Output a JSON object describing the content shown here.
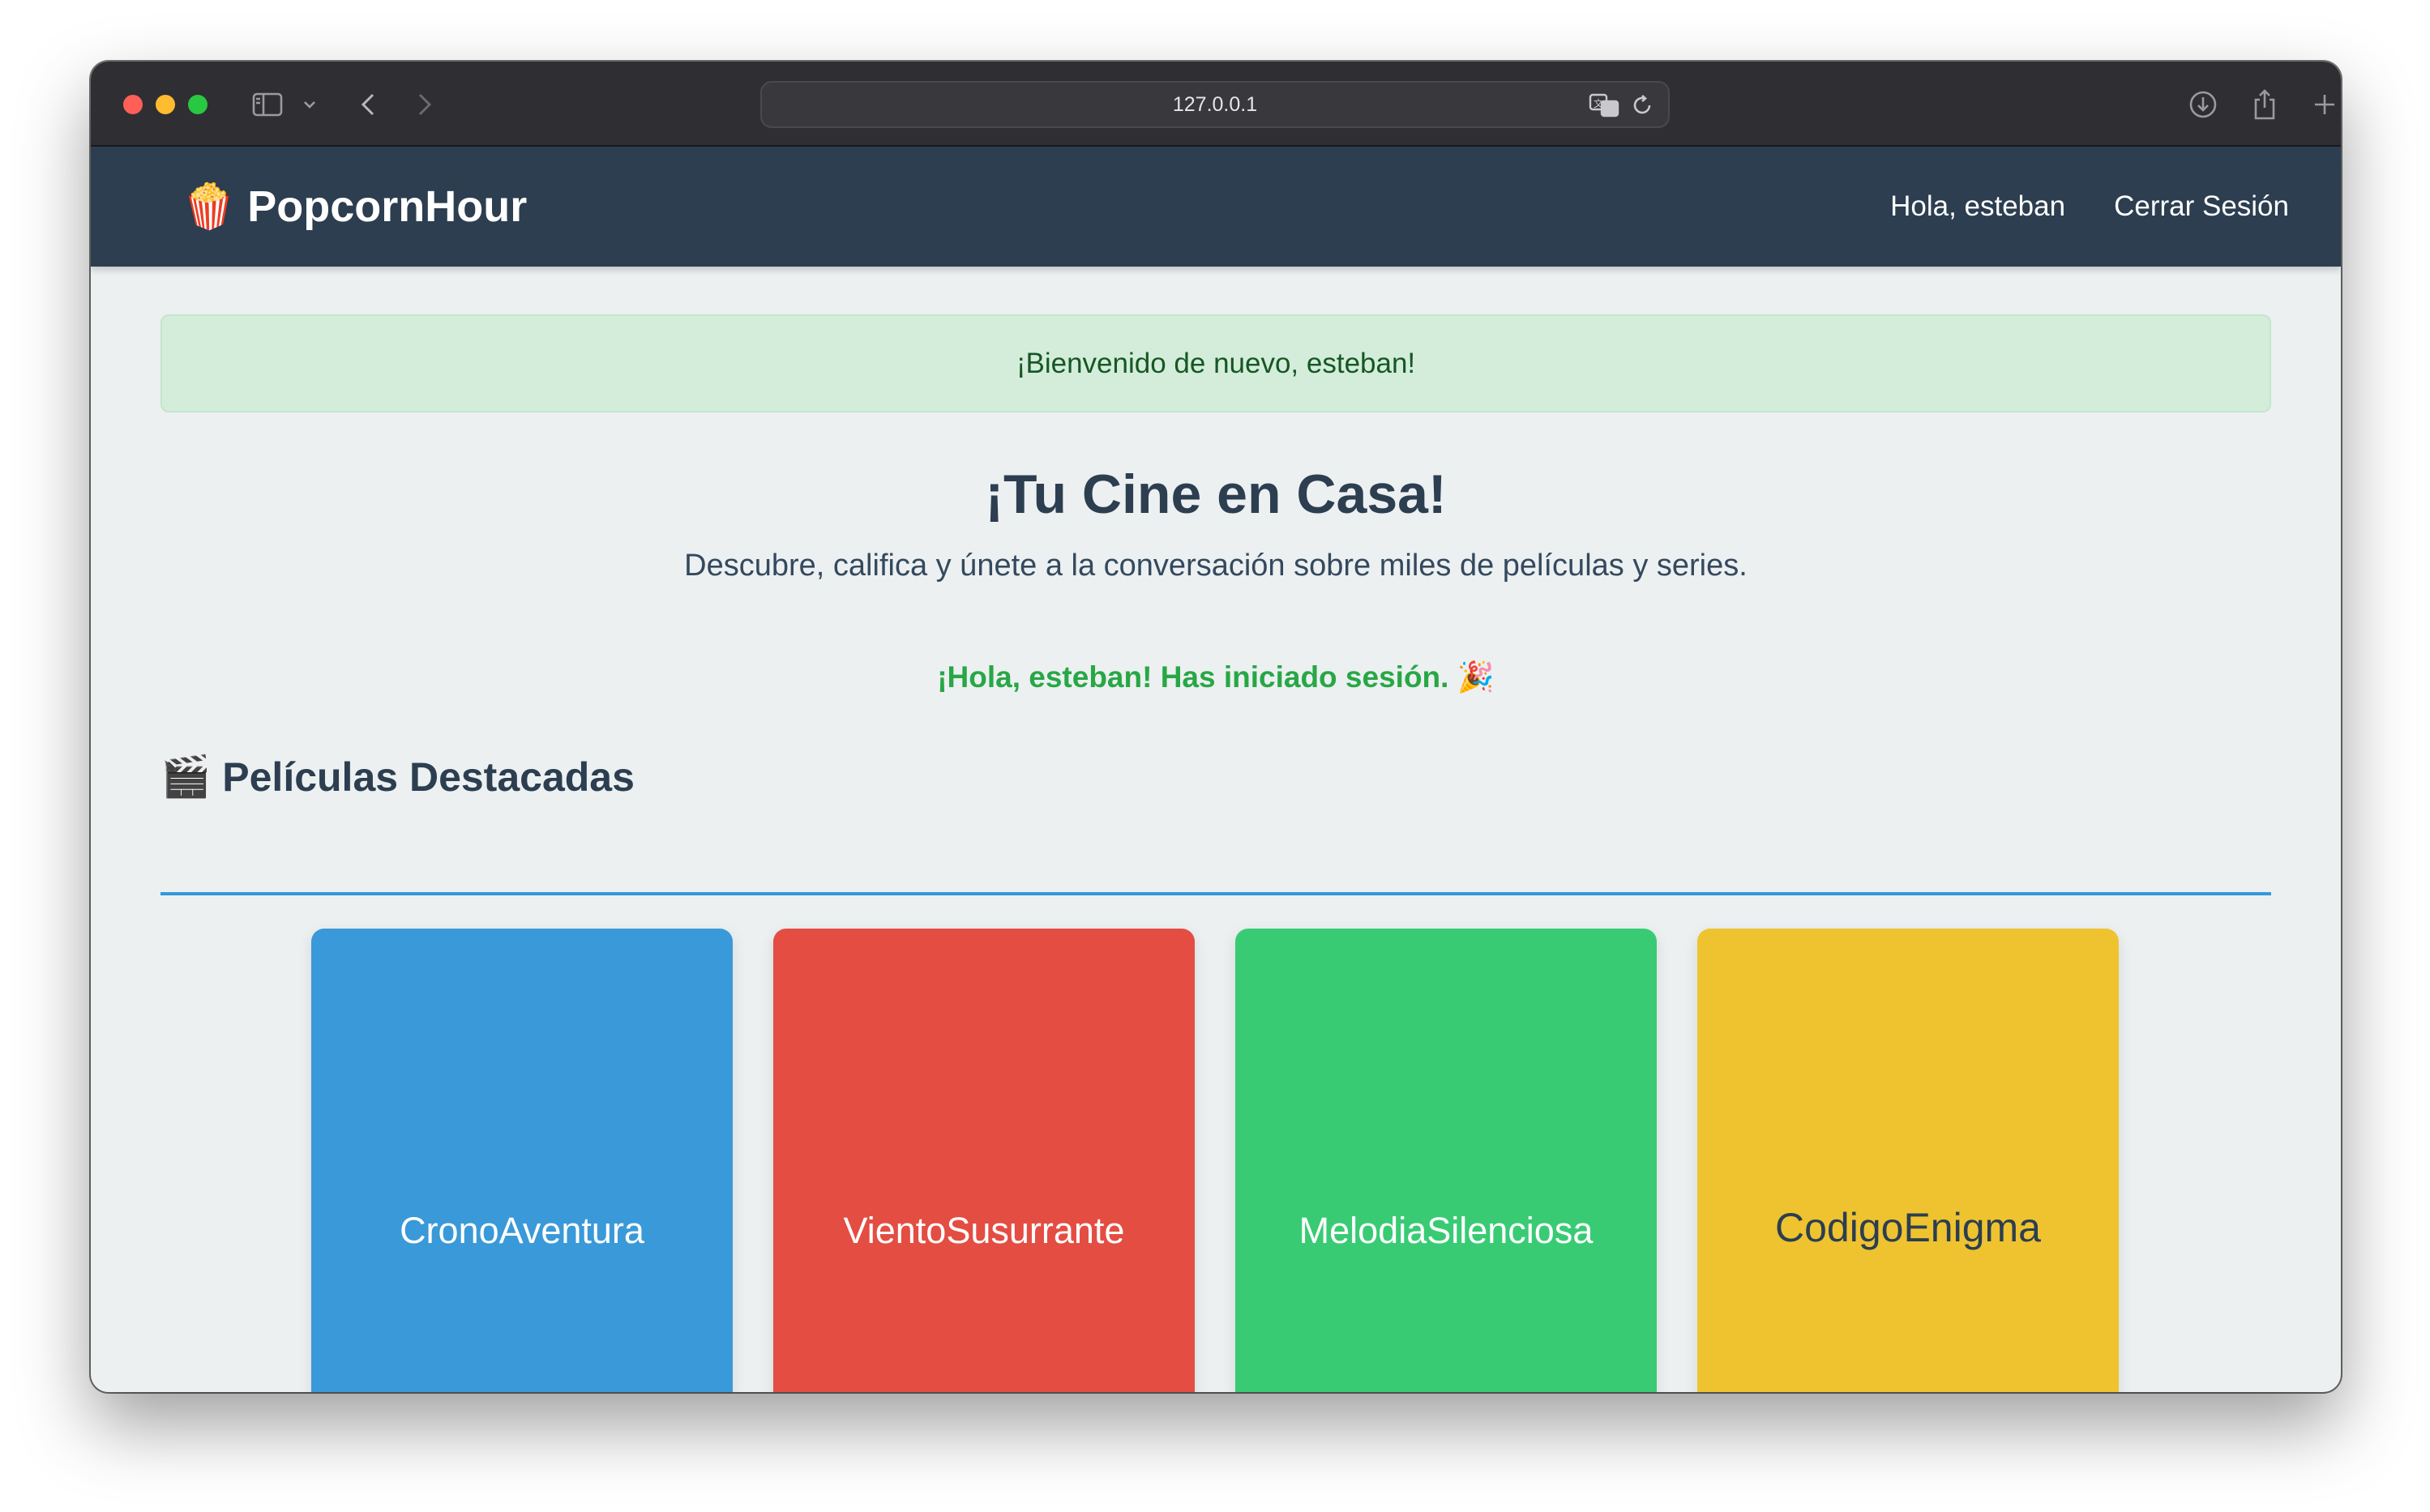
{
  "browser": {
    "url": "127.0.0.1",
    "icons": [
      "sidebar-icon",
      "chevron-down-icon",
      "back-icon",
      "forward-icon",
      "translate-icon",
      "reload-icon",
      "download-icon",
      "share-icon",
      "new-tab-icon",
      "tabs-overview-icon"
    ]
  },
  "header": {
    "logo_emoji": "🍿",
    "brand": "PopcornHour",
    "greeting": "Hola, esteban",
    "logout": "Cerrar Sesión"
  },
  "alert": {
    "message": "¡Bienvenido de nuevo, esteban!"
  },
  "hero": {
    "title": "¡Tu Cine en Casa!",
    "subtitle": "Descubre, califica y únete a la conversación sobre miles de películas y series.",
    "logged_message": "¡Hola, esteban! Has iniciado sesión. 🎉"
  },
  "featured": {
    "icon": "🎬",
    "title": "Películas Destacadas",
    "movies": [
      {
        "title": "CronoAventura",
        "color": "#3a99d8"
      },
      {
        "title": "VientoSusurrante",
        "color": "#e44d42"
      },
      {
        "title": "MelodiaSilenciosa",
        "color": "#39cb74"
      },
      {
        "title": "CodigoEnigma",
        "color": "#eec32f"
      }
    ]
  },
  "colors": {
    "header_bg": "#2c3e50",
    "page_bg": "#ecf0f1",
    "accent": "#3498db",
    "success": "#28a745"
  }
}
